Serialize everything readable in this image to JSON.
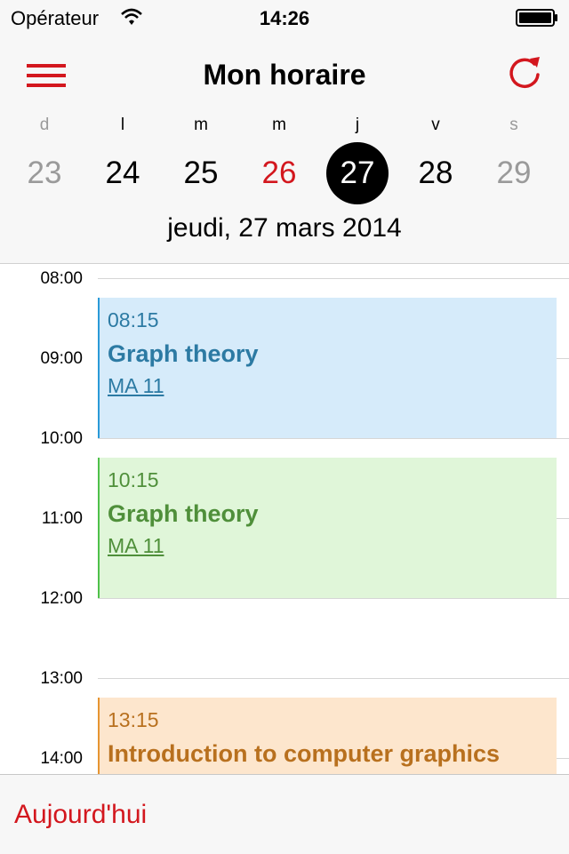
{
  "status_bar": {
    "carrier": "Opérateur",
    "time": "14:26"
  },
  "header": {
    "title": "Mon horaire",
    "menu_icon": "hamburger-icon",
    "refresh_icon": "refresh-icon"
  },
  "week": {
    "days": [
      {
        "letter": "d",
        "number": "23",
        "state": "weekend"
      },
      {
        "letter": "l",
        "number": "24",
        "state": "normal"
      },
      {
        "letter": "m",
        "number": "25",
        "state": "normal"
      },
      {
        "letter": "m",
        "number": "26",
        "state": "today"
      },
      {
        "letter": "j",
        "number": "27",
        "state": "selected"
      },
      {
        "letter": "v",
        "number": "28",
        "state": "normal"
      },
      {
        "letter": "s",
        "number": "29",
        "state": "weekend"
      }
    ],
    "selected_date": "jeudi, 27 mars 2014"
  },
  "timeline": {
    "hours": [
      "08:00",
      "09:00",
      "10:00",
      "11:00",
      "12:00",
      "13:00",
      "14:00"
    ],
    "events": [
      {
        "time": "08:15",
        "title": "Graph theory",
        "room": "MA 11",
        "color": "blue"
      },
      {
        "time": "10:15",
        "title": "Graph theory",
        "room": "MA 11",
        "color": "green"
      },
      {
        "time": "13:15",
        "title": "Introduction to computer graphics",
        "room": "",
        "color": "orange"
      }
    ]
  },
  "toolbar": {
    "today_label": "Aujourd'hui"
  },
  "colors": {
    "accent": "#d3171e",
    "blue_event": "#d6ebfa",
    "green_event": "#e0f6d9",
    "orange_event": "#fde6cd"
  }
}
